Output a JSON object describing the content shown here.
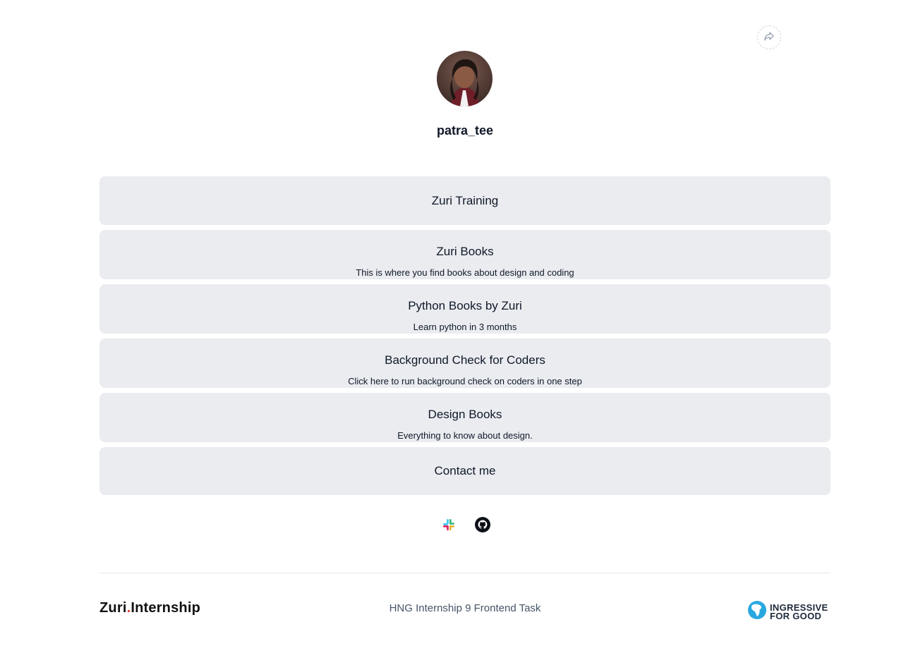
{
  "share": {
    "icon": "share-icon"
  },
  "profile": {
    "name": "patra_tee",
    "avatar_icon": "avatar"
  },
  "links": [
    {
      "title": "Zuri Training",
      "subtitle": ""
    },
    {
      "title": "Zuri Books",
      "subtitle": "This is where you find books about design and coding"
    },
    {
      "title": "Python Books by Zuri",
      "subtitle": "Learn python in 3 months"
    },
    {
      "title": "Background Check for Coders",
      "subtitle": "Click here to run background check on coders in one step"
    },
    {
      "title": "Design Books",
      "subtitle": "Everything to know about design."
    },
    {
      "title": "Contact me",
      "subtitle": ""
    }
  ],
  "socials": [
    {
      "icon": "slack-icon"
    },
    {
      "icon": "github-icon"
    }
  ],
  "footer": {
    "zuri_logo": {
      "part1": "Zuri",
      "dot": ".",
      "part2": "Internship"
    },
    "text": "HNG Internship 9 Frontend Task",
    "i4g_logo": {
      "line1": "INGRESSIVE",
      "line2": "FOR GOOD"
    }
  },
  "colors": {
    "link_bg": "#eaecf0",
    "text": "#101828",
    "muted": "#475467",
    "zuri_dot": "#e53935",
    "i4g_blue": "#29a8e0"
  }
}
